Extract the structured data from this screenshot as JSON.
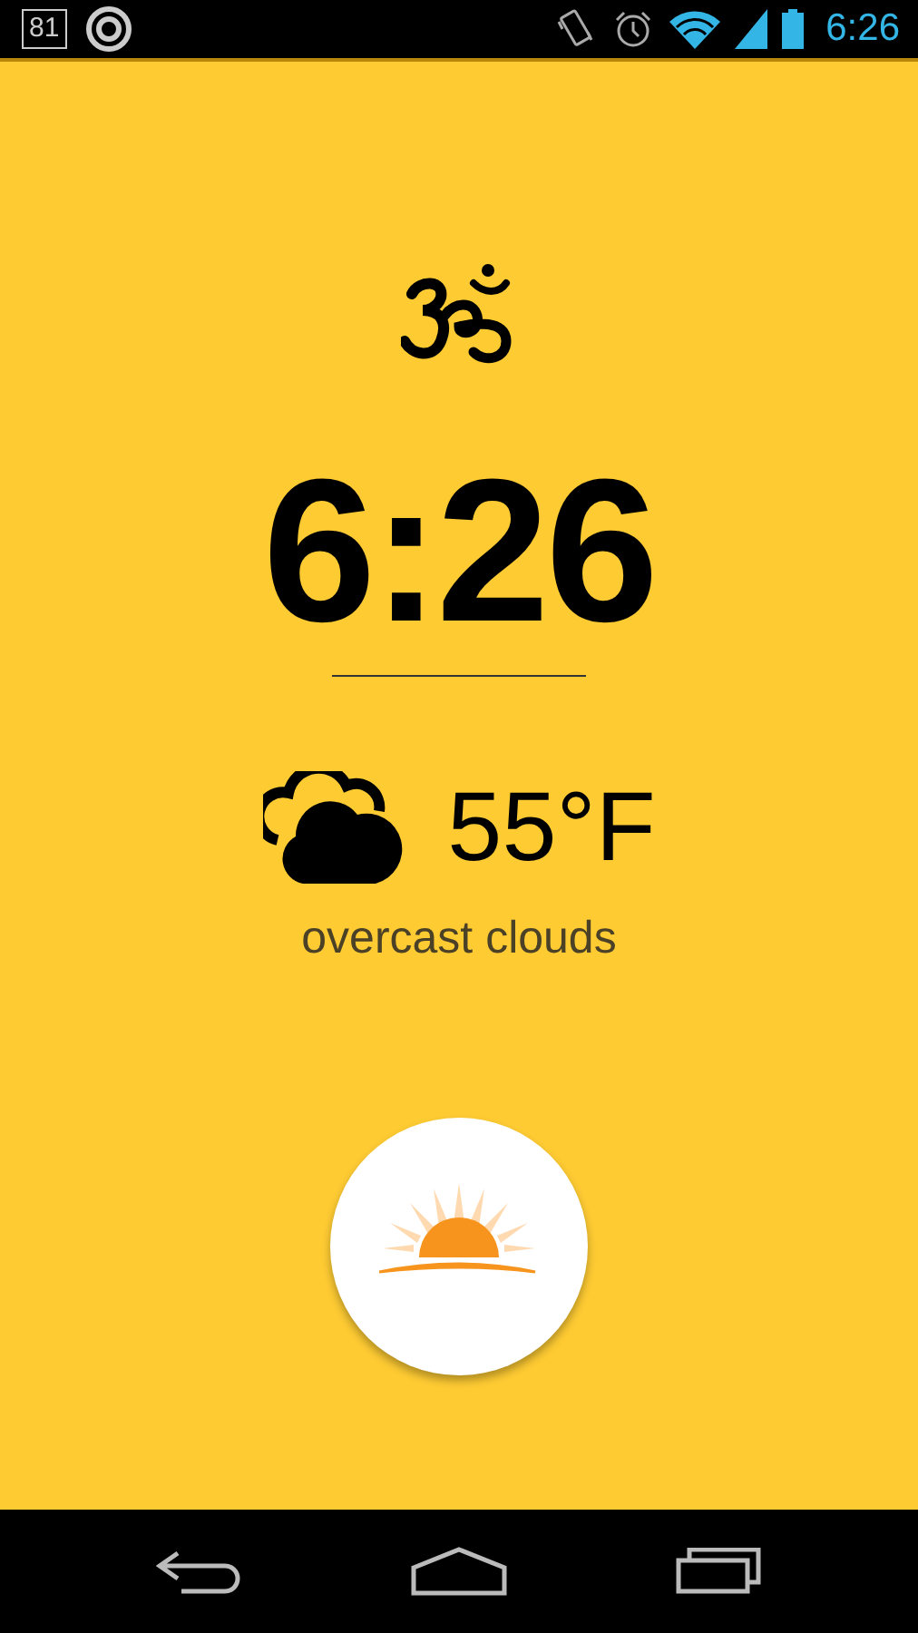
{
  "status_bar": {
    "notification_count": "81",
    "time": "6:26"
  },
  "clock": {
    "time": "6:26"
  },
  "weather": {
    "temperature": "55°F",
    "description": "overcast clouds"
  }
}
